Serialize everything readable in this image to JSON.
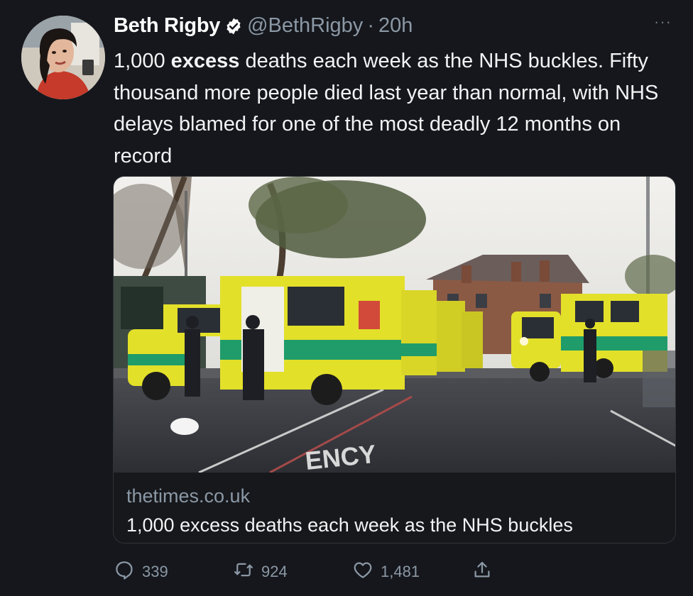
{
  "tweet": {
    "author_name": "Beth Rigby",
    "handle": "@BethRigby",
    "separator": "·",
    "time": "20h",
    "more_label": "···",
    "text_start": "1,000 ",
    "text_bold": "excess",
    "text_end": " deaths each week as the NHS buckles. Fifty thousand more people died last year than normal, with NHS delays blamed for one of the most deadly 12 months on record"
  },
  "card": {
    "domain": "thetimes.co.uk",
    "title": "1,000 excess deaths each week as the NHS buckles",
    "image_road_text": "ENCY"
  },
  "actions": {
    "replies": "339",
    "retweets": "924",
    "likes": "1,481"
  },
  "colors": {
    "background": "#15171c",
    "text": "#f1f3f4",
    "muted": "#8b98a5",
    "border": "#2f3336",
    "ambulance_yellow": "#e3e02a",
    "ambulance_green": "#1f9c6a"
  },
  "icons": {
    "verified": "verified-badge-icon",
    "reply": "reply-icon",
    "retweet": "retweet-icon",
    "like": "heart-icon",
    "share": "share-icon",
    "more": "more-icon"
  }
}
